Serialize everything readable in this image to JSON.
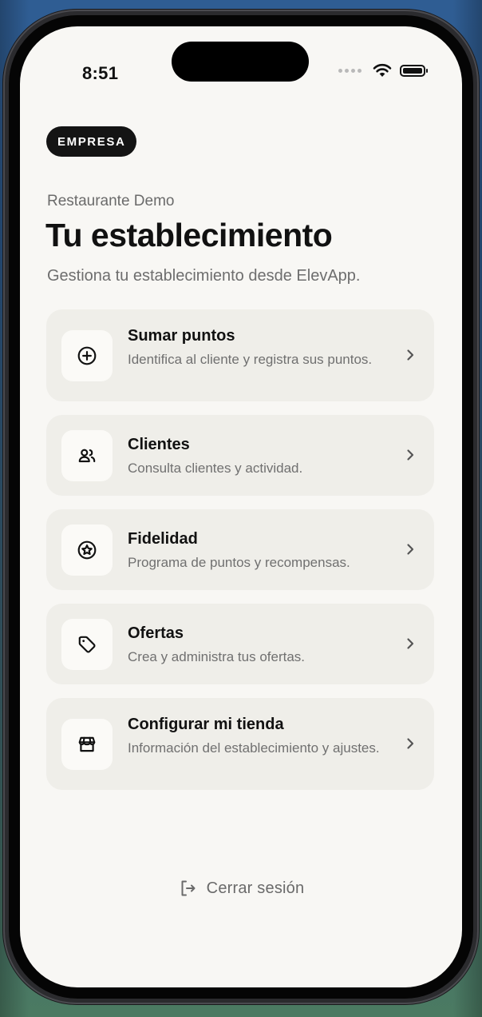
{
  "status_bar": {
    "time": "8:51",
    "icons": [
      "cellular-signal-icon",
      "wifi-icon",
      "battery-icon"
    ]
  },
  "header": {
    "badge": "EMPRESA",
    "business_name": "Restaurante Demo",
    "title": "Tu establecimiento",
    "description": "Gestiona tu establecimiento desde ElevApp."
  },
  "menu": {
    "items": [
      {
        "title": "Sumar puntos",
        "description": "Identifica al cliente y registra sus puntos.",
        "icon": "plus-circle-icon"
      },
      {
        "title": "Clientes",
        "description": "Consulta clientes y actividad.",
        "icon": "users-icon"
      },
      {
        "title": "Fidelidad",
        "description": "Programa de puntos y recompensas.",
        "icon": "star-badge-icon"
      },
      {
        "title": "Ofertas",
        "description": "Crea y administra tus ofertas.",
        "icon": "tag-icon"
      },
      {
        "title": "Configurar mi tienda",
        "description": "Información del establecimiento y ajustes.",
        "icon": "store-icon"
      }
    ]
  },
  "footer": {
    "logout_label": "Cerrar sesión",
    "logout_icon": "logout-icon"
  },
  "colors": {
    "screen_background": "#f8f7f4",
    "card_background": "#efeee9",
    "badge_background": "#141414",
    "text_primary": "#111111",
    "text_secondary": "#6e6e6e"
  }
}
